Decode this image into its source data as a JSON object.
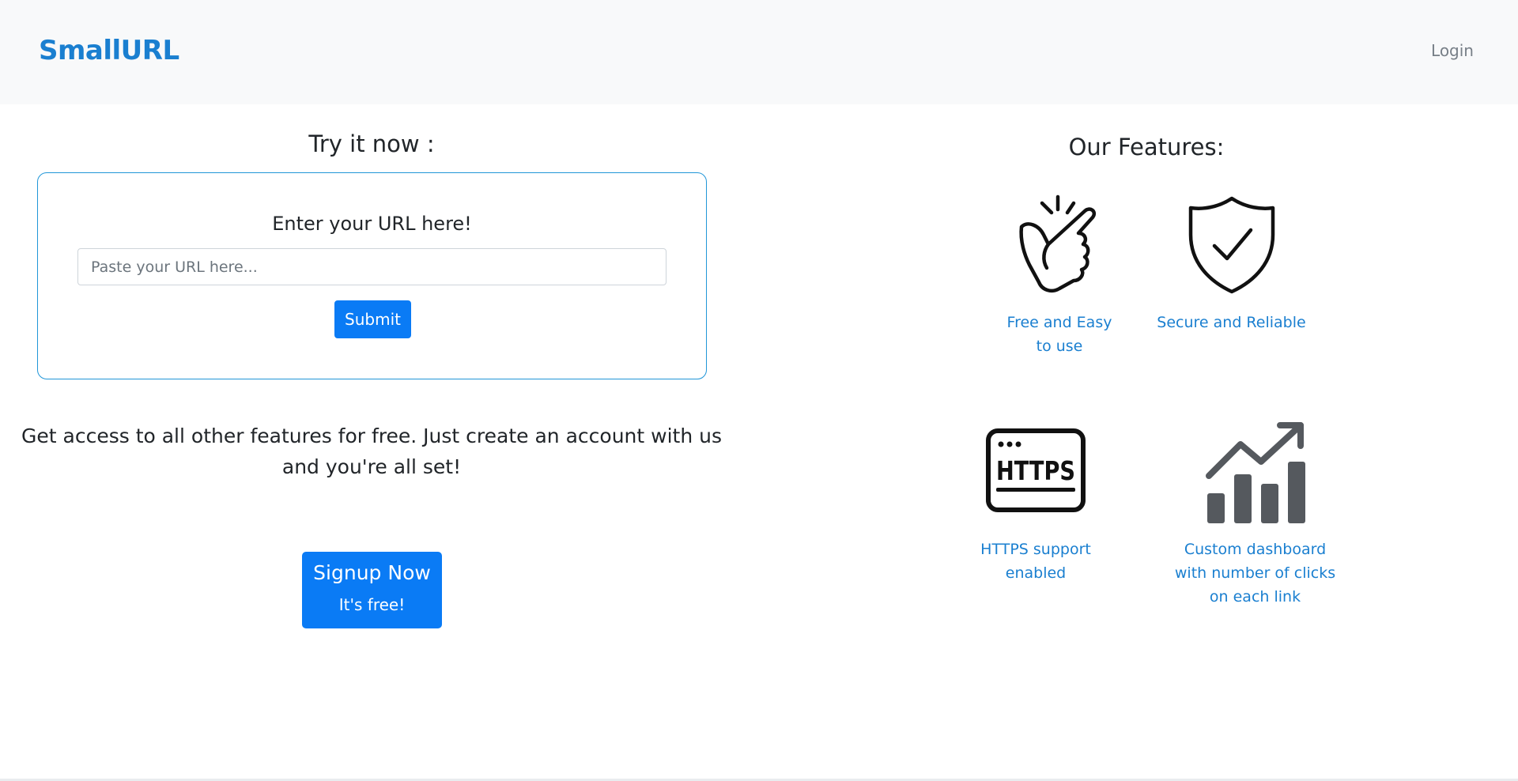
{
  "navbar": {
    "brand": "SmallURL",
    "login": "Login"
  },
  "shortener": {
    "section_title": "Try it now :",
    "card_title": "Enter your URL here!",
    "input_placeholder": "Paste your URL here...",
    "input_value": "",
    "submit_label": "Submit"
  },
  "promo": {
    "text": "Get access to all other features for free. Just create an account with us and you're all set!",
    "signup_label": "Signup Now",
    "signup_sublabel": "It's free!"
  },
  "features": {
    "title": "Our Features:",
    "items": [
      {
        "label": "Free and Easy to use",
        "icon": "snap-fingers-icon"
      },
      {
        "label": "Secure and Reliable",
        "icon": "shield-check-icon"
      },
      {
        "label": "HTTPS support enabled",
        "icon": "https-icon"
      },
      {
        "label": "Custom dashboard with number of clicks on each link",
        "icon": "chart-growth-icon"
      }
    ]
  },
  "colors": {
    "brand": "#1a7fd0",
    "primary_button": "#0a7bf5",
    "card_border": "#2196d8",
    "navbar_bg": "#f8f9fa"
  }
}
